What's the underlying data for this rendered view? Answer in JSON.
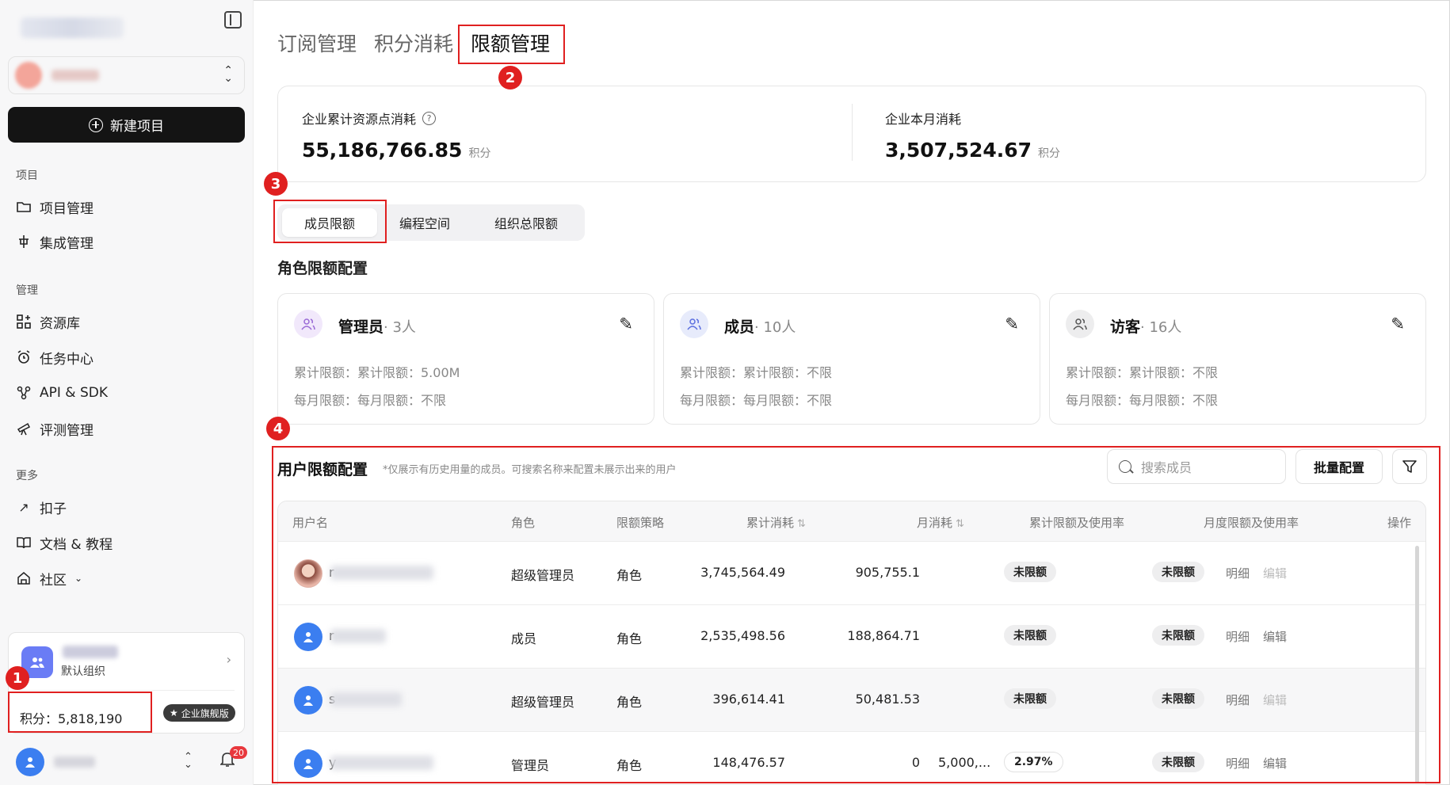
{
  "sidebar": {
    "new_project": "新建项目",
    "section_project": "项目",
    "section_manage": "管理",
    "section_more": "更多",
    "items_project": [
      {
        "label": "项目管理",
        "icon": "folder-icon"
      },
      {
        "label": "集成管理",
        "icon": "integration-icon"
      }
    ],
    "items_manage": [
      {
        "label": "资源库",
        "icon": "grid-plus-icon"
      },
      {
        "label": "任务中心",
        "icon": "alarm-clock-icon"
      },
      {
        "label": "API & SDK",
        "icon": "api-nodes-icon"
      },
      {
        "label": "评测管理",
        "icon": "telescope-icon"
      }
    ],
    "items_more": [
      {
        "label": "扣子",
        "icon": "arrow-up-right-icon"
      },
      {
        "label": "文档 & 教程",
        "icon": "book-icon"
      },
      {
        "label": "社区",
        "icon": "community-icon"
      }
    ],
    "org": {
      "subtitle": "默认组织",
      "points_label": "积分：5,818,190",
      "badge": "企业旗舰版"
    },
    "notifications": "20"
  },
  "annotations": [
    "1",
    "2",
    "3",
    "4"
  ],
  "main": {
    "tabs": [
      "订阅管理",
      "积分消耗",
      "限额管理"
    ],
    "active_tab": "限额管理",
    "stats": {
      "total_label": "企业累计资源点消耗",
      "total_value": "55,186,766.85",
      "month_label": "企业本月消耗",
      "month_value": "3,507,524.67",
      "unit": "积分",
      "help": "?"
    },
    "sub_tabs": [
      "成员限额",
      "编程空间",
      "组织总限额"
    ],
    "role_section_title": "角色限额配置",
    "roles": [
      {
        "name": "管理员",
        "count": "· 3人",
        "total": "累计限额：累计限额：5.00M",
        "monthly": "每月限额：每月限额：不限",
        "color": "#f1e8fb",
        "icon_color": "#9a6ad6"
      },
      {
        "name": "成员",
        "count": "· 10人",
        "total": "累计限额：累计限额：不限",
        "monthly": "每月限额：每月限额：不限",
        "color": "#e7ebfb",
        "icon_color": "#5b6fe0"
      },
      {
        "name": "访客",
        "count": "· 16人",
        "total": "累计限额：累计限额：不限",
        "monthly": "每月限额：每月限额：不限",
        "color": "#ededee",
        "icon_color": "#555"
      }
    ],
    "user_section": {
      "title": "用户限额配置",
      "note": "*仅展示有历史用量的成员。可搜索名称来配置未展示出来的用户",
      "search_placeholder": "搜索成员",
      "batch_button": "批量配置"
    },
    "table": {
      "headers": [
        "用户名",
        "角色",
        "限额策略",
        "累计消耗",
        "月消耗",
        "累计限额及使用率",
        "月度限额及使用率",
        "操作"
      ],
      "sort_glyph": "⇅",
      "rows": [
        {
          "initial": "r",
          "role": "超级管理员",
          "strategy": "角色",
          "total": "3,745,564.49",
          "monthly": "905,755.1",
          "total_limit": "",
          "total_pill": "未限额",
          "month_pill": "未限额",
          "detail": "明细",
          "edit": "编辑",
          "edit_enabled": false
        },
        {
          "initial": "r",
          "role": "成员",
          "strategy": "角色",
          "total": "2,535,498.56",
          "monthly": "188,864.71",
          "total_limit": "",
          "total_pill": "未限额",
          "month_pill": "未限额",
          "detail": "明细",
          "edit": "编辑",
          "edit_enabled": true
        },
        {
          "initial": "s",
          "role": "超级管理员",
          "strategy": "角色",
          "total": "396,614.41",
          "monthly": "50,481.53",
          "total_limit": "",
          "total_pill": "未限额",
          "month_pill": "未限额",
          "detail": "明细",
          "edit": "编辑",
          "edit_enabled": false
        },
        {
          "initial": "y",
          "role": "管理员",
          "strategy": "角色",
          "total": "148,476.57",
          "monthly": "0",
          "total_limit": "5,000,...",
          "total_pill": "2.97%",
          "month_pill": "未限额",
          "detail": "明细",
          "edit": "编辑",
          "edit_enabled": true
        }
      ]
    }
  }
}
